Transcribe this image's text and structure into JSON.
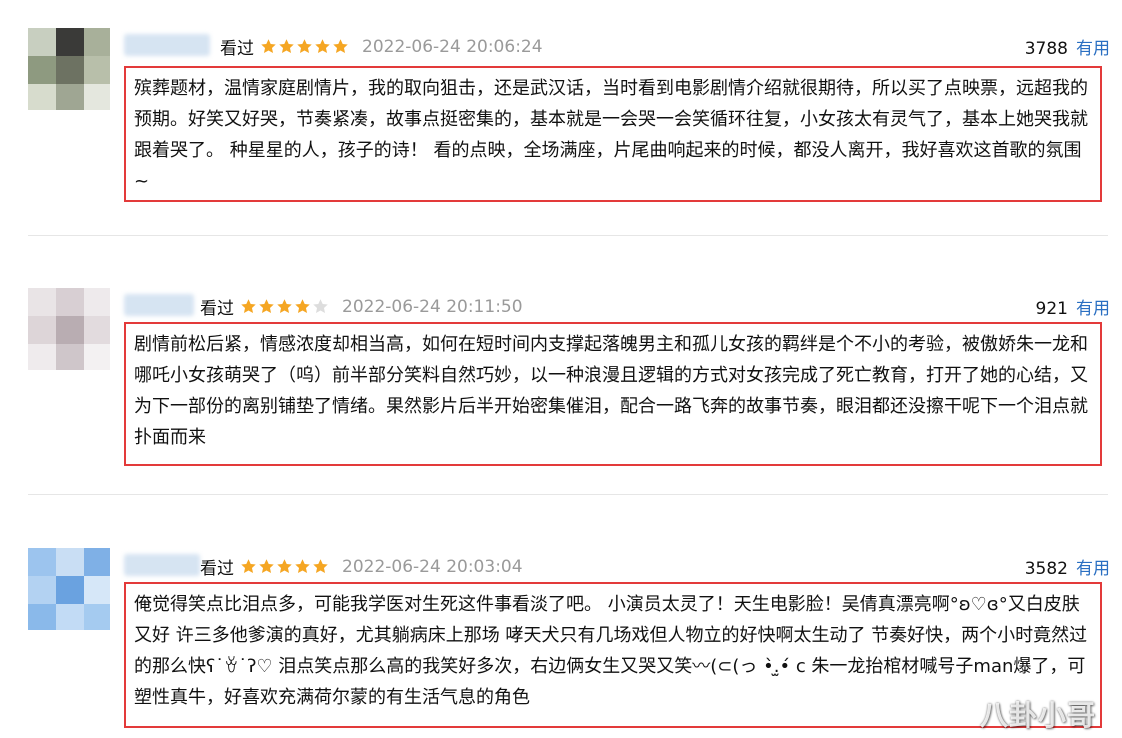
{
  "reviews": [
    {
      "watched_label": "看过",
      "rating": 5,
      "date": "2022-06-24 20:06:24",
      "useful_count": "3788",
      "useful_label": "有用",
      "text": "殡葬题材，温情家庭剧情片，我的取向狙击，还是武汉话，当时看到电影剧情介绍就很期待，所以买了点映票，远超我的预期。好笑又好哭，节奏紧凑，故事点挺密集的，基本就是一会哭一会笑循环往复，小女孩太有灵气了，基本上她哭我就跟着哭了。 种星星的人，孩子的诗！ 看的点映，全场满座，片尾曲响起来的时候，都没人离开，我好喜欢这首歌的氛围~"
    },
    {
      "watched_label": "看过",
      "rating": 4,
      "date": "2022-06-24 20:11:50",
      "useful_count": "921",
      "useful_label": "有用",
      "text": "剧情前松后紧，情感浓度却相当高，如何在短时间内支撑起落魄男主和孤儿女孩的羁绊是个不小的考验，被傲娇朱一龙和哪吒小女孩萌哭了（呜）前半部分笑料自然巧妙，以一种浪漫且逻辑的方式对女孩完成了死亡教育，打开了她的心结，又为下一部份的离别铺垫了情绪。果然影片后半开始密集催泪，配合一路飞奔的故事节奏，眼泪都还没擦干呢下一个泪点就扑面而来"
    },
    {
      "watched_label": "看过",
      "rating": 5,
      "date": "2022-06-24 20:03:04",
      "useful_count": "3582",
      "useful_label": "有用",
      "text": "俺觉得笑点比泪点多，可能我学医对生死这件事看淡了吧。 小演员太灵了！天生电影脸！吴倩真漂亮啊°ʚ♡ɞ°又白皮肤又好 许三多他爹演的真好，尤其躺病床上那场 哮天犬只有几场戏但人物立的好快啊太生动了 节奏好快，两个小时竟然过的那么快ʕ˙ꈊ˙ʔ♡ 泪点笑点那么高的我笑好多次，右边俩女生又哭又笑〰(⊂(っ •̀.̫•́ c 朱一龙抬棺材喊号子man爆了，可塑性真牛，好喜欢充满荷尔蒙的有生活气息的角色"
    }
  ],
  "colors": {
    "star": "#f5a623",
    "star_empty": "#dddddd",
    "highlight_border": "#e33a3a",
    "link": "#2a6fc2",
    "date": "#9a9a9a"
  },
  "icons": {
    "star": "star-icon"
  },
  "watermark": "八卦小哥"
}
